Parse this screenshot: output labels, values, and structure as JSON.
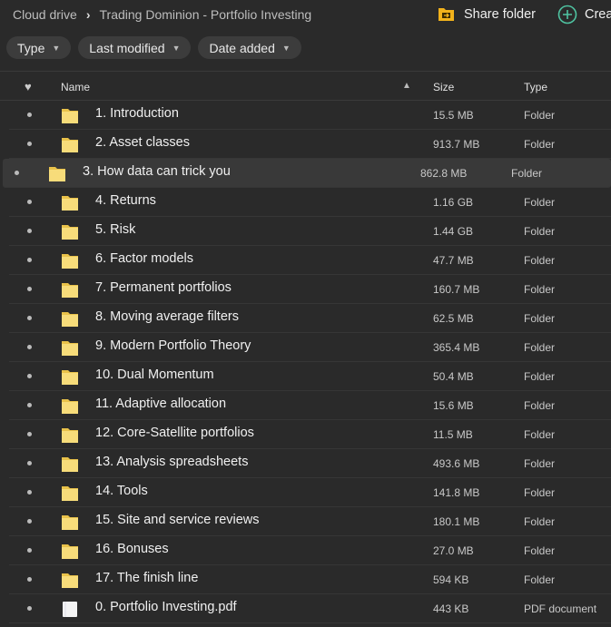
{
  "breadcrumb": {
    "root": "Cloud drive",
    "current": "Trading Dominion - Portfolio Investing"
  },
  "toolbar": {
    "share_label": "Share folder",
    "create_label": "Crea"
  },
  "filters": [
    "Type",
    "Last modified",
    "Date added"
  ],
  "columns": {
    "name": "Name",
    "size": "Size",
    "type": "Type"
  },
  "colors": {
    "folder": "#f2c94c",
    "accent": "#4fc3a1",
    "selected_row": "#393939"
  },
  "rows": [
    {
      "name": "1. Introduction",
      "size": "15.5 MB",
      "type": "Folder",
      "icon": "folder"
    },
    {
      "name": "2. Asset classes",
      "size": "913.7 MB",
      "type": "Folder",
      "icon": "folder"
    },
    {
      "name": "3. How data can trick you",
      "size": "862.8 MB",
      "type": "Folder",
      "icon": "folder",
      "selected": true
    },
    {
      "name": "4. Returns",
      "size": "1.16 GB",
      "type": "Folder",
      "icon": "folder"
    },
    {
      "name": "5. Risk",
      "size": "1.44 GB",
      "type": "Folder",
      "icon": "folder"
    },
    {
      "name": "6. Factor models",
      "size": "47.7 MB",
      "type": "Folder",
      "icon": "folder"
    },
    {
      "name": "7. Permanent portfolios",
      "size": "160.7 MB",
      "type": "Folder",
      "icon": "folder"
    },
    {
      "name": "8. Moving average filters",
      "size": "62.5 MB",
      "type": "Folder",
      "icon": "folder"
    },
    {
      "name": "9. Modern Portfolio Theory",
      "size": "365.4 MB",
      "type": "Folder",
      "icon": "folder"
    },
    {
      "name": "10. Dual Momentum",
      "size": "50.4 MB",
      "type": "Folder",
      "icon": "folder"
    },
    {
      "name": "11. Adaptive allocation",
      "size": "15.6 MB",
      "type": "Folder",
      "icon": "folder"
    },
    {
      "name": "12. Core-Satellite portfolios",
      "size": "11.5 MB",
      "type": "Folder",
      "icon": "folder"
    },
    {
      "name": "13. Analysis spreadsheets",
      "size": "493.6 MB",
      "type": "Folder",
      "icon": "folder"
    },
    {
      "name": "14. Tools",
      "size": "141.8 MB",
      "type": "Folder",
      "icon": "folder"
    },
    {
      "name": "15. Site and service reviews",
      "size": "180.1 MB",
      "type": "Folder",
      "icon": "folder"
    },
    {
      "name": "16. Bonuses",
      "size": "27.0 MB",
      "type": "Folder",
      "icon": "folder"
    },
    {
      "name": "17. The finish line",
      "size": "594 KB",
      "type": "Folder",
      "icon": "folder"
    },
    {
      "name": "0. Portfolio Investing.pdf",
      "size": "443 KB",
      "type": "PDF document",
      "icon": "pdf-file"
    }
  ]
}
